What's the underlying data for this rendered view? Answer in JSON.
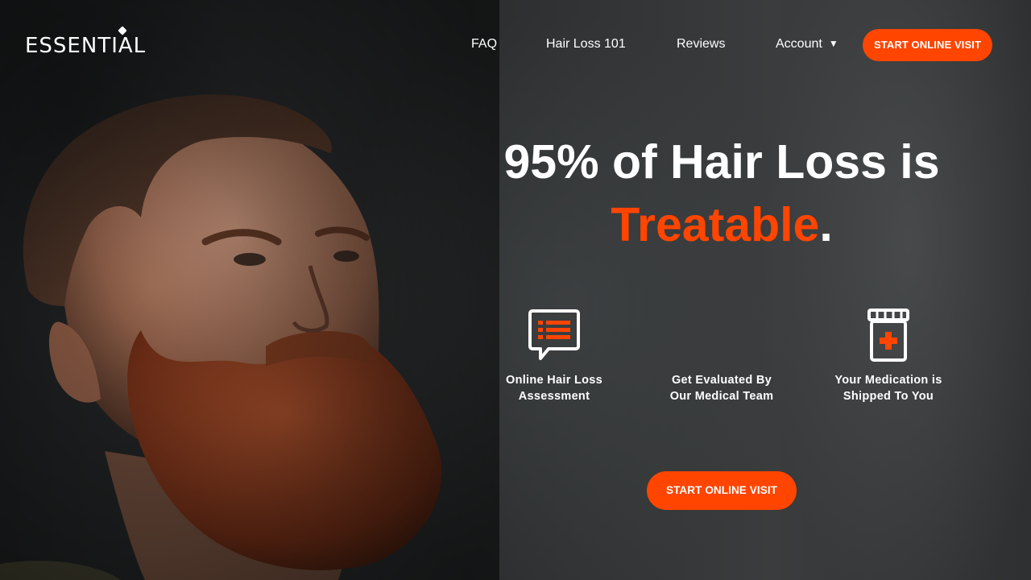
{
  "brand": {
    "logo_text": "ESSENTIAL"
  },
  "nav": {
    "links": [
      {
        "label": "FAQ"
      },
      {
        "label": "Hair Loss 101"
      },
      {
        "label": "Reviews"
      },
      {
        "label": "Account",
        "arrow": "▼"
      }
    ],
    "cta_label": "START ONLINE VISIT"
  },
  "hero": {
    "headline_line1": "95% of Hair Loss is",
    "headline_accent": "Treatable",
    "headline_period": ".",
    "accent_color": "#ff4500",
    "steps": [
      {
        "icon": "chat-list-icon",
        "line1": "Online Hair Loss",
        "line2": "Assessment"
      },
      {
        "icon": "medical-team-icon",
        "line1": "Get Evaluated By",
        "line2": "Our Medical Team"
      },
      {
        "icon": "medicine-bottle-icon",
        "line1": "Your Medication is",
        "line2": "Shipped To You"
      }
    ],
    "cta_label": "START ONLINE VISIT"
  }
}
